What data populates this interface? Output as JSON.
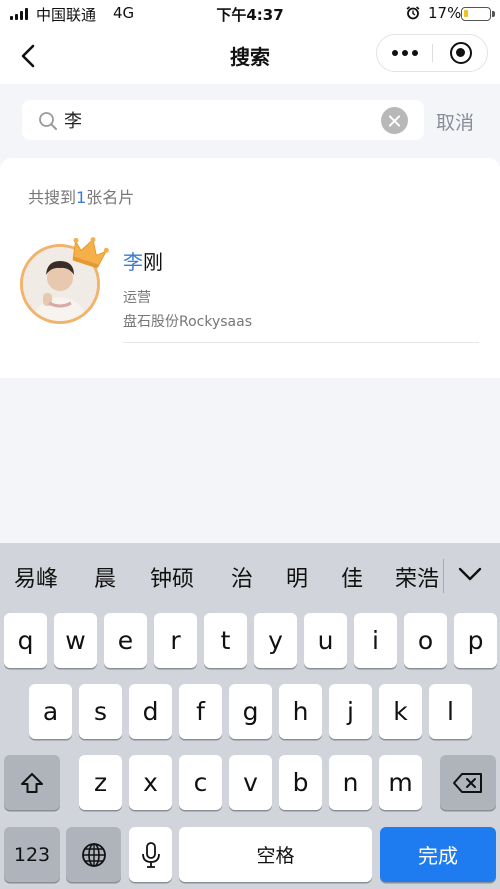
{
  "status_bar": {
    "carrier": "中国联通",
    "network": "4G",
    "time": "下午4:37",
    "battery": "17%",
    "battery_level": 0.17
  },
  "nav": {
    "title": "搜索"
  },
  "search": {
    "value": "李",
    "cancel_label": "取消"
  },
  "results": {
    "count_prefix": "共搜到",
    "count_value": "1",
    "count_suffix": "张名片",
    "cards": [
      {
        "name_highlight": "李",
        "name_rest": "刚",
        "title": "运营",
        "company": "盘石股份Rockysaas"
      }
    ]
  },
  "keyboard": {
    "candidates": [
      "易峰",
      "晨",
      "钟硕",
      "治",
      "明",
      "佳",
      "荣浩"
    ],
    "row1": [
      "q",
      "w",
      "e",
      "r",
      "t",
      "y",
      "u",
      "i",
      "o",
      "p"
    ],
    "row2": [
      "a",
      "s",
      "d",
      "f",
      "g",
      "h",
      "j",
      "k",
      "l"
    ],
    "row3": [
      "z",
      "x",
      "c",
      "v",
      "b",
      "n",
      "m"
    ],
    "numbers_label": "123",
    "space_label": "空格",
    "done_label": "完成"
  },
  "colors": {
    "accent": "#3a7bd5",
    "done_key": "#1f7cf0",
    "avatar_ring": "#f2b36b",
    "crown": "#f5b04a"
  },
  "icons": [
    "back-arrow-icon",
    "more-dots-icon",
    "close-target-icon",
    "search-icon",
    "clear-icon",
    "crown-icon",
    "chevron-down-icon",
    "shift-icon",
    "backspace-icon",
    "globe-icon",
    "microphone-icon"
  ]
}
